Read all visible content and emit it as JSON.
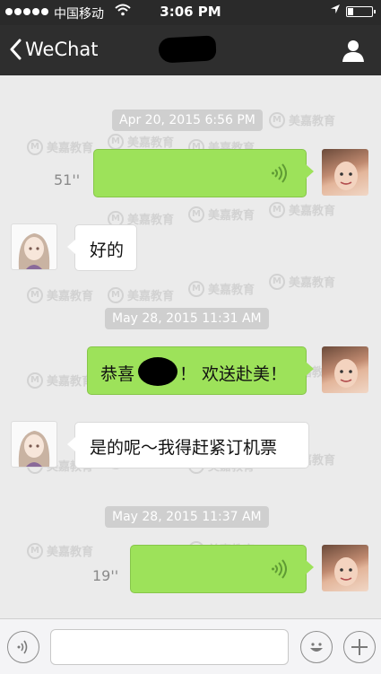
{
  "status_bar": {
    "carrier": "中国移动",
    "time": "3:06 PM"
  },
  "nav": {
    "back_label": "WeChat"
  },
  "watermark_text": "美嘉教育",
  "messages": [
    {
      "type": "timestamp",
      "text": "Apr 20, 2015 6:56 PM"
    },
    {
      "type": "voice",
      "sender": "me",
      "duration": "51''"
    },
    {
      "type": "text",
      "sender": "other",
      "text": "好的"
    },
    {
      "type": "timestamp",
      "text": "May 28, 2015 11:31 AM"
    },
    {
      "type": "text",
      "sender": "me",
      "text_before": "恭喜",
      "text_after": "！ 欢送赴美！"
    },
    {
      "type": "text",
      "sender": "other",
      "text": "是的呢～我得赶紧订机票"
    },
    {
      "type": "timestamp",
      "text": "May 28, 2015 11:37 AM"
    },
    {
      "type": "voice",
      "sender": "me",
      "duration": "19''"
    }
  ],
  "input_bar": {
    "text_value": "",
    "icons": [
      "voice-mode-icon",
      "emoji-icon",
      "plus-icon"
    ]
  },
  "colors": {
    "my_bubble": "#9de25a",
    "other_bubble": "#ffffff",
    "nav_background": "#2e2e2e",
    "chat_background": "#ebebeb",
    "timestamp_background": "#cfcfcf"
  }
}
